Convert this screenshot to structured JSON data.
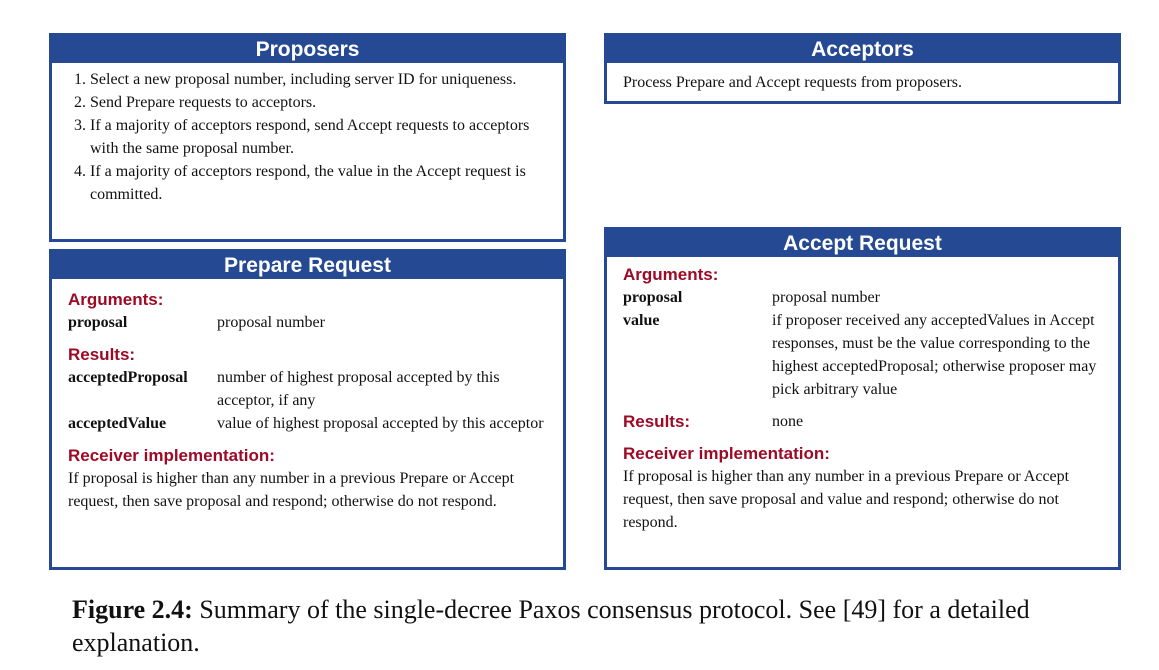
{
  "proposers": {
    "title": "Proposers",
    "steps": [
      "Select a new proposal number, including server ID for uniqueness.",
      "Send Prepare requests to acceptors.",
      "If a majority of acceptors respond, send Accept requests to acceptors with the same proposal number.",
      "If a majority of acceptors respond, the value in the Accept request is committed."
    ]
  },
  "acceptors": {
    "title": "Acceptors",
    "text": "Process Prepare and Accept requests from proposers."
  },
  "prepare": {
    "title": "Prepare Request",
    "arguments_heading": "Arguments:",
    "arguments": [
      {
        "key": "proposal",
        "value": "proposal number"
      }
    ],
    "results_heading": "Results:",
    "results": [
      {
        "key": "acceptedProposal",
        "value": "number of highest proposal accepted by this acceptor, if any"
      },
      {
        "key": "acceptedValue",
        "value": "value of highest proposal accepted by this acceptor"
      }
    ],
    "impl_heading": "Receiver implementation:",
    "impl_text": "If proposal is higher than any number in a previous Prepare or Accept request, then save proposal and respond; otherwise do not respond."
  },
  "accept": {
    "title": "Accept Request",
    "arguments_heading": "Arguments:",
    "arguments": [
      {
        "key": "proposal",
        "value": "proposal number"
      },
      {
        "key": "value",
        "value": "if proposer received any acceptedValues in Accept responses, must be the value corresponding to the highest acceptedProposal; otherwise proposer may pick arbitrary value"
      }
    ],
    "results_heading": "Results:",
    "results_value": "none",
    "impl_heading": "Receiver implementation:",
    "impl_text": "If proposal is higher than any number in a previous Prepare or Accept request, then save proposal and value and respond; otherwise do not respond."
  },
  "caption": {
    "label": "Figure 2.4:",
    "text": "Summary of the single-decree Paxos consensus protocol. See [49] for a detailed explanation."
  }
}
